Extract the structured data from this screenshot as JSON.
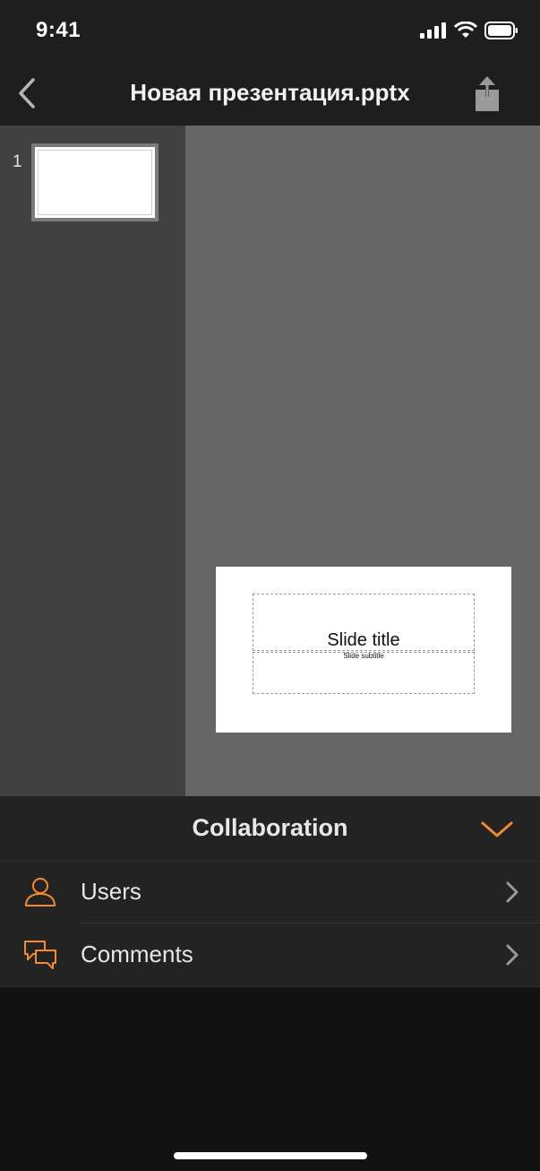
{
  "status_bar": {
    "time": "9:41"
  },
  "nav": {
    "title": "Новая презентация.pptx",
    "back_icon": "chevron-left-icon",
    "share_icon": "share-icon"
  },
  "thumbnails": [
    {
      "number": "1"
    }
  ],
  "slide": {
    "title": "Slide title",
    "subtitle": "Slide subtitle"
  },
  "collaboration": {
    "title": "Collaboration",
    "items": [
      {
        "label": "Users",
        "icon": "user-icon"
      },
      {
        "label": "Comments",
        "icon": "comments-icon"
      }
    ]
  },
  "colors": {
    "accent": "#f28b30",
    "bar_bg": "#1e1e1e",
    "thumbs_bg": "#414141",
    "canvas_bg": "#666666",
    "panel_bg": "#232323"
  }
}
